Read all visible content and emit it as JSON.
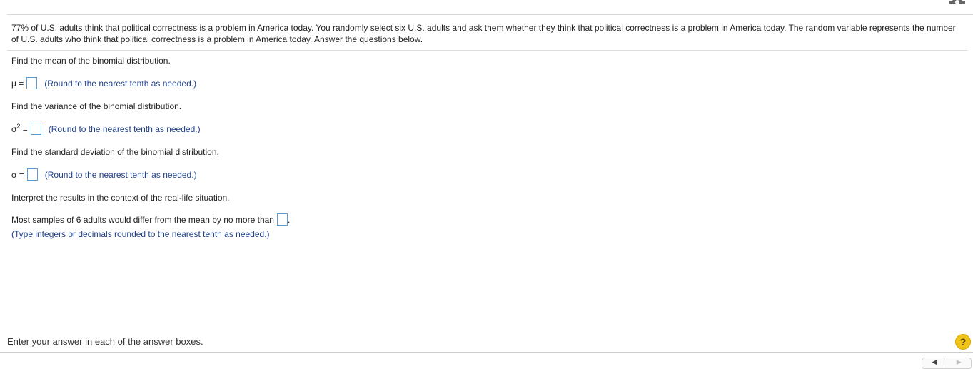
{
  "problem_text": "77% of U.S. adults think that political correctness is a problem in America today. You randomly select six U.S. adults and ask them whether they think that political correctness is a problem in America today. The random variable represents the number of U.S. adults who think that political correctness is a problem in America today. Answer the questions below.",
  "questions": {
    "mean_prompt": "Find the mean of the binomial distribution.",
    "mean_symbol": "μ =",
    "mean_hint": "(Round to the nearest tenth as needed.)",
    "variance_prompt": "Find the variance of the binomial distribution.",
    "variance_symbol_base": "σ",
    "variance_symbol_exp": "2",
    "variance_symbol_eq": " =",
    "variance_hint": "(Round to the nearest tenth as needed.)",
    "sd_prompt": "Find the standard deviation of the binomial distribution.",
    "sd_symbol": "σ =",
    "sd_hint": "(Round to the nearest tenth as needed.)",
    "interpret_prompt": "Interpret the results in the context of the real-life situation.",
    "interpret_sentence": "Most samples of 6 adults would differ from the mean by no more than",
    "interpret_period": ".",
    "interpret_hint": "(Type integers or decimals rounded to the nearest tenth as needed.)"
  },
  "answers": {
    "mean": "",
    "variance": "",
    "sd": "",
    "interpret": ""
  },
  "footer": {
    "instruction": "Enter your answer in each of the answer boxes.",
    "help_label": "?",
    "pager_prev": "◀",
    "pager_next": "▶"
  },
  "icons": {
    "settings": "gear-icon",
    "help": "help-icon"
  },
  "colors": {
    "hint": "#1f3f8a",
    "box_border": "#5b9bd5",
    "help": "#f0c419"
  }
}
